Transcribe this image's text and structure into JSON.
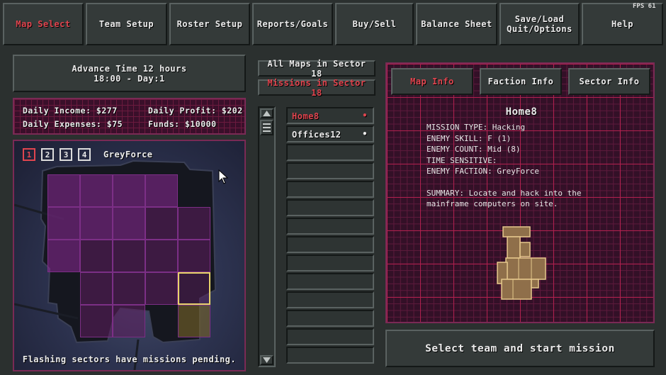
{
  "fps": "FPS 61",
  "nav": [
    {
      "label": "Map Select",
      "active": true
    },
    {
      "label": "Team Setup"
    },
    {
      "label": "Roster Setup"
    },
    {
      "label": "Reports/Goals"
    },
    {
      "label": "Buy/Sell"
    },
    {
      "label": "Balance Sheet"
    },
    {
      "label_line1": "Save/Load",
      "label_line2": "Quit/Options"
    },
    {
      "label": "Help"
    }
  ],
  "advance": {
    "line1": "Advance Time 12 hours",
    "line2": "18:00 - Day:1"
  },
  "finance": {
    "daily_income": "Daily Income: $277",
    "daily_profit": "Daily Profit: $202",
    "daily_expenses": "Daily Expenses: $75",
    "funds": "Funds: $10000"
  },
  "team_tabs": [
    "1",
    "2",
    "3",
    "4"
  ],
  "selected_team": "1",
  "team_name": "GreyForce",
  "map_footer": "Flashing sectors have missions pending.",
  "filters": {
    "all_maps": "All Maps in Sector 18",
    "missions": "Missions in Sector 18"
  },
  "missions": [
    {
      "name": "Home8",
      "marker": "•",
      "selected": true
    },
    {
      "name": "Offices12",
      "marker": "•",
      "selected": false
    }
  ],
  "info_tabs": {
    "map": "Map Info",
    "faction": "Faction Info",
    "sector": "Sector Info"
  },
  "mission_info": {
    "title": "Home8",
    "type": "MISSION TYPE: Hacking",
    "skill": "ENEMY SKILL: F (1)",
    "count": "ENEMY COUNT: Mid (8)",
    "time": "TIME SENSITIVE:",
    "faction": "ENEMY FACTION: GreyForce",
    "summary_line1": "SUMMARY: Locate and hack into the",
    "summary_line2": "mainframe computers on site."
  },
  "start_button": "Select team and start mission",
  "colors": {
    "accent_red": "#e0454f",
    "grid_line": "#b0204e",
    "grid_bg": "#3a0f2a",
    "sector_highlight": "#e8d36a"
  },
  "icons": {
    "scroll_up": "triangle-up",
    "scroll_down": "triangle-down",
    "cursor": "arrow-pointer"
  }
}
